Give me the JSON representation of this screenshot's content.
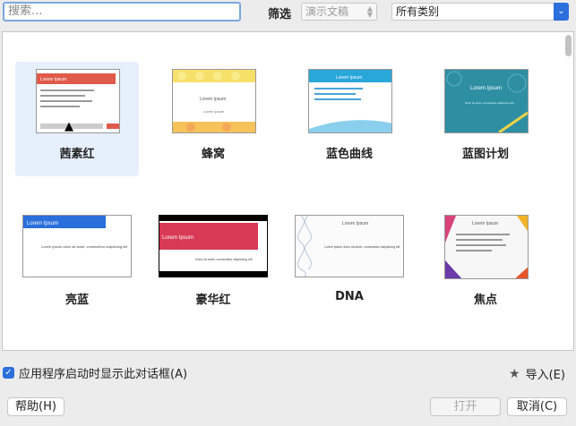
{
  "search": {
    "placeholder": "搜索..."
  },
  "filter": {
    "label": "筛选",
    "doc_type": "演示文稿",
    "category": "所有类别"
  },
  "templates": [
    {
      "label": "茜素红",
      "thumb_title": "Lorem Ipsum"
    },
    {
      "label": "蜂窝",
      "thumb_title": "Lorem Ipsum",
      "thumb_sub": "Lorem ipsum"
    },
    {
      "label": "蓝色曲线",
      "thumb_title": "Lorem Ipsum"
    },
    {
      "label": "蓝图计划",
      "thumb_title": "Lorem Ipsum",
      "thumb_sub": "Dolor sit amet, consectetur adipiscing elit"
    },
    {
      "label": "亮蓝",
      "thumb_title": "Lorem Ipsum",
      "thumb_sub": "Lorem ipsum dolor sit amet, consectetur adipiscing elit"
    },
    {
      "label": "豪华红",
      "thumb_title": "Lorem Ipsum",
      "thumb_sub": "Dolor sit amet, consectetur adipiscing elit"
    },
    {
      "label": "DNA",
      "thumb_title": "Lorem Ipsum",
      "thumb_sub": "Lorem ipsum dolor sit amet, consectetur adipiscing elit"
    },
    {
      "label": "焦点",
      "thumb_title": "Lorem Ipsum"
    }
  ],
  "footer": {
    "show_on_start_label": "应用程序启动时显示此对话框(A)",
    "show_on_start_checked": true,
    "import_label": "导入(E)",
    "help_label": "帮助(H)",
    "open_label": "打开",
    "cancel_label": "取消(C)"
  },
  "colors": {
    "accent": "#2a6fdb",
    "selection": "#e6effc"
  }
}
